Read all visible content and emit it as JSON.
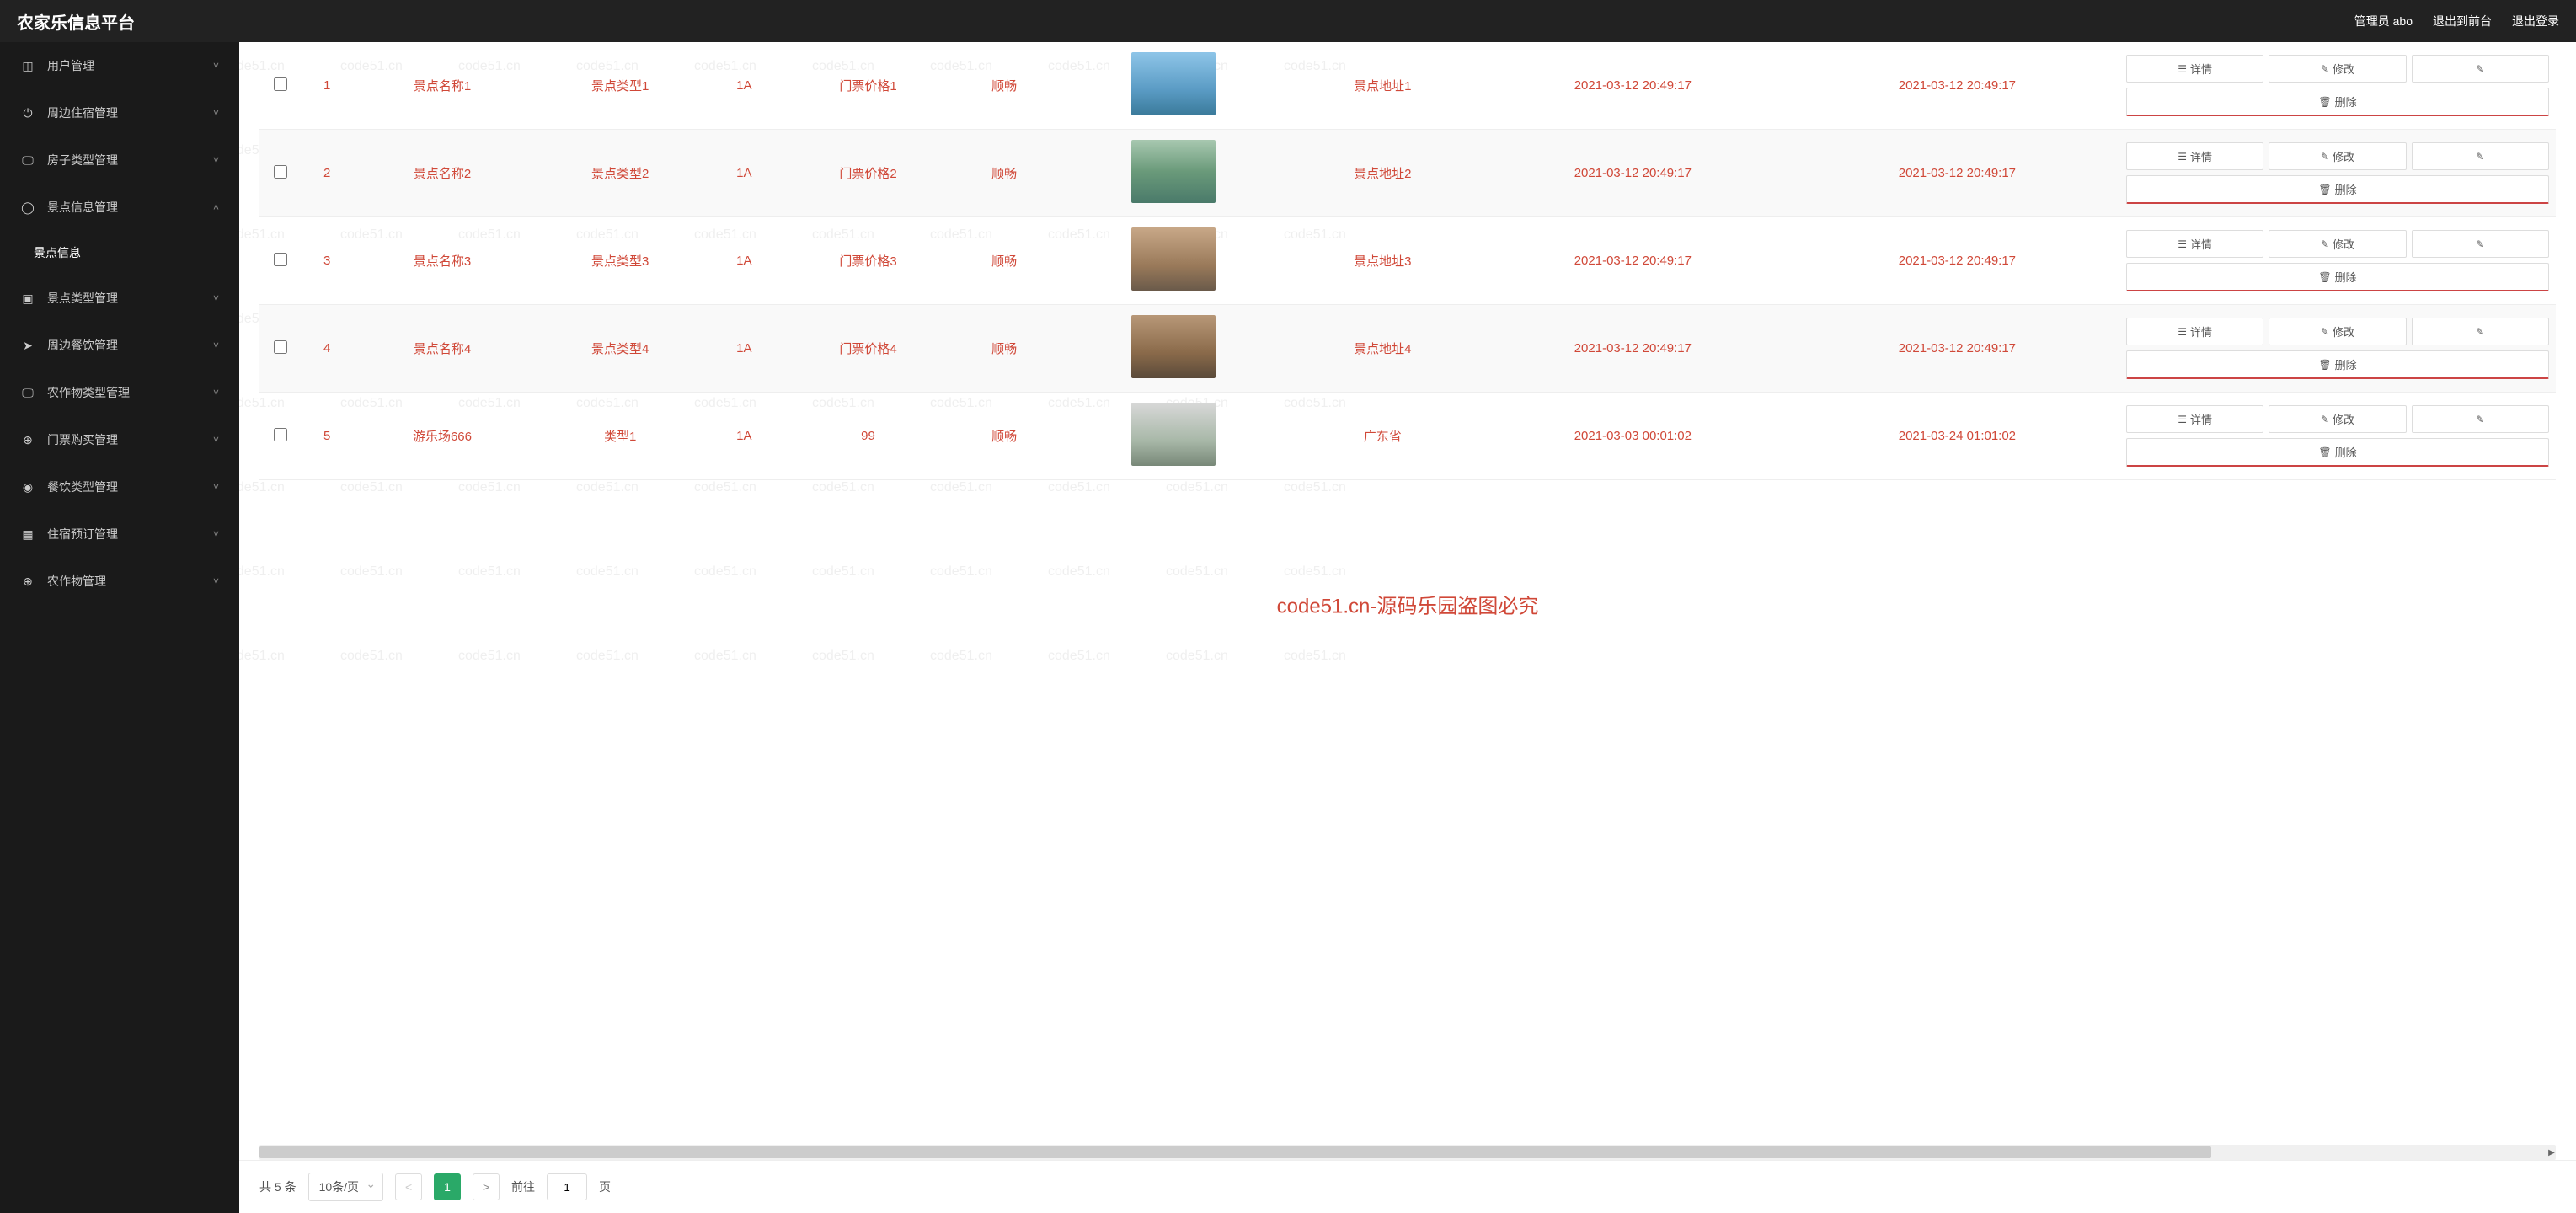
{
  "header": {
    "title": "农家乐信息平台",
    "admin": "管理员 abo",
    "logout_front": "退出到前台",
    "logout": "退出登录"
  },
  "sidebar": {
    "items": [
      {
        "icon": "user",
        "label": "用户管理",
        "expanded": false
      },
      {
        "icon": "power",
        "label": "周边住宿管理",
        "expanded": false
      },
      {
        "icon": "monitor",
        "label": "房子类型管理",
        "expanded": false
      },
      {
        "icon": "circle",
        "label": "景点信息管理",
        "expanded": true
      },
      {
        "icon": "user-alt",
        "label": "景点类型管理",
        "expanded": false
      },
      {
        "icon": "send",
        "label": "周边餐饮管理",
        "expanded": false
      },
      {
        "icon": "monitor",
        "label": "农作物类型管理",
        "expanded": false
      },
      {
        "icon": "plus-circle",
        "label": "门票购买管理",
        "expanded": false
      },
      {
        "icon": "bulb",
        "label": "餐饮类型管理",
        "expanded": false
      },
      {
        "icon": "grid",
        "label": "住宿预订管理",
        "expanded": false
      },
      {
        "icon": "plus-circle",
        "label": "农作物管理",
        "expanded": false
      }
    ],
    "submenu": "景点信息"
  },
  "watermark_center": "code51.cn-源码乐园盗图必究",
  "watermark_text": "code51.cn",
  "table": {
    "rows": [
      {
        "idx": "1",
        "name": "景点名称1",
        "type": "景点类型1",
        "level": "1A",
        "price": "门票价格1",
        "status": "顺畅",
        "addr": "景点地址1",
        "t1": "2021-03-12 20:49:17",
        "t2": "2021-03-12 20:49:17"
      },
      {
        "idx": "2",
        "name": "景点名称2",
        "type": "景点类型2",
        "level": "1A",
        "price": "门票价格2",
        "status": "顺畅",
        "addr": "景点地址2",
        "t1": "2021-03-12 20:49:17",
        "t2": "2021-03-12 20:49:17"
      },
      {
        "idx": "3",
        "name": "景点名称3",
        "type": "景点类型3",
        "level": "1A",
        "price": "门票价格3",
        "status": "顺畅",
        "addr": "景点地址3",
        "t1": "2021-03-12 20:49:17",
        "t2": "2021-03-12 20:49:17"
      },
      {
        "idx": "4",
        "name": "景点名称4",
        "type": "景点类型4",
        "level": "1A",
        "price": "门票价格4",
        "status": "顺畅",
        "addr": "景点地址4",
        "t1": "2021-03-12 20:49:17",
        "t2": "2021-03-12 20:49:17"
      },
      {
        "idx": "5",
        "name": "游乐场666",
        "type": "类型1",
        "level": "1A",
        "price": "99",
        "status": "顺畅",
        "addr": "广东省",
        "t1": "2021-03-03 00:01:02",
        "t2": "2021-03-24 01:01:02"
      }
    ]
  },
  "actions": {
    "detail": "详情",
    "edit": "修改",
    "delete": "删除"
  },
  "pagination": {
    "total": "共 5 条",
    "per_page": "10条/页",
    "current": "1",
    "goto_pre": "前往",
    "goto_val": "1",
    "goto_post": "页"
  }
}
